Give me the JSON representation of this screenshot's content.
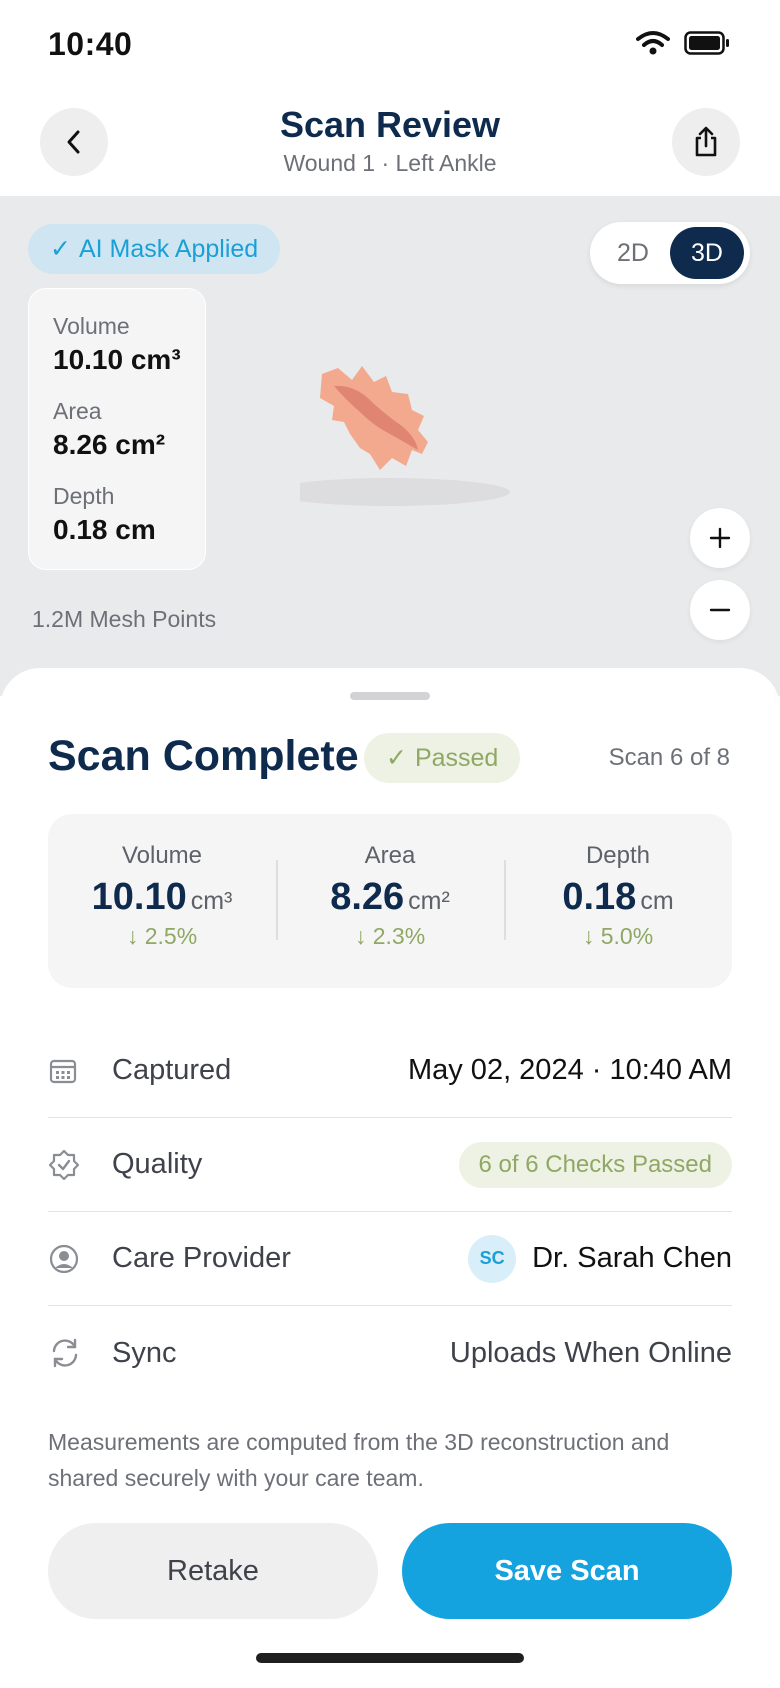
{
  "status_bar": {
    "time": "10:40",
    "icons": [
      "wifi-icon",
      "battery-icon"
    ]
  },
  "header": {
    "title": "Scan Review",
    "subtitle": "Wound 1 · Left Ankle",
    "back_icon": "chevron-left-icon",
    "share_icon": "share-icon"
  },
  "viewer": {
    "ai_badge": "AI Mask Applied",
    "view_toggle": {
      "options": [
        "2D",
        "3D"
      ],
      "selected": "3D"
    },
    "measurements": [
      {
        "label": "Volume",
        "value": "10.10 cm³"
      },
      {
        "label": "Area",
        "value": "8.26 cm²"
      },
      {
        "label": "Depth",
        "value": "0.18 cm"
      }
    ],
    "mesh_points": "1.2M Mesh Points",
    "zoom_in": "+",
    "zoom_out": "−"
  },
  "sheet": {
    "title": "Scan Complete",
    "status_badge": "Passed",
    "scan_counter": "Scan 6 of 8",
    "stats": [
      {
        "label": "Volume",
        "value": "10.10",
        "unit": "cm³",
        "delta": "2.5%"
      },
      {
        "label": "Area",
        "value": "8.26",
        "unit": "cm²",
        "delta": "2.3%"
      },
      {
        "label": "Depth",
        "value": "0.18",
        "unit": "cm",
        "delta": "5.0%"
      }
    ],
    "details": {
      "captured": {
        "label": "Captured",
        "value": "May 02, 2024 · 10:40 AM"
      },
      "quality": {
        "label": "Quality",
        "value": "6 of 6 Checks Passed"
      },
      "provider": {
        "label": "Care Provider",
        "initials": "SC",
        "value": "Dr. Sarah Chen"
      },
      "sync": {
        "label": "Sync",
        "value": "Uploads When Online"
      }
    },
    "footnote": "Measurements are computed from the 3D reconstruction and shared securely with your care team.",
    "actions": {
      "retake": "Retake",
      "save": "Save Scan"
    }
  },
  "colors": {
    "primary": "#0e2a4d",
    "accent": "#14a3de",
    "success": "#8fa864",
    "wound": "#f2a98e"
  }
}
